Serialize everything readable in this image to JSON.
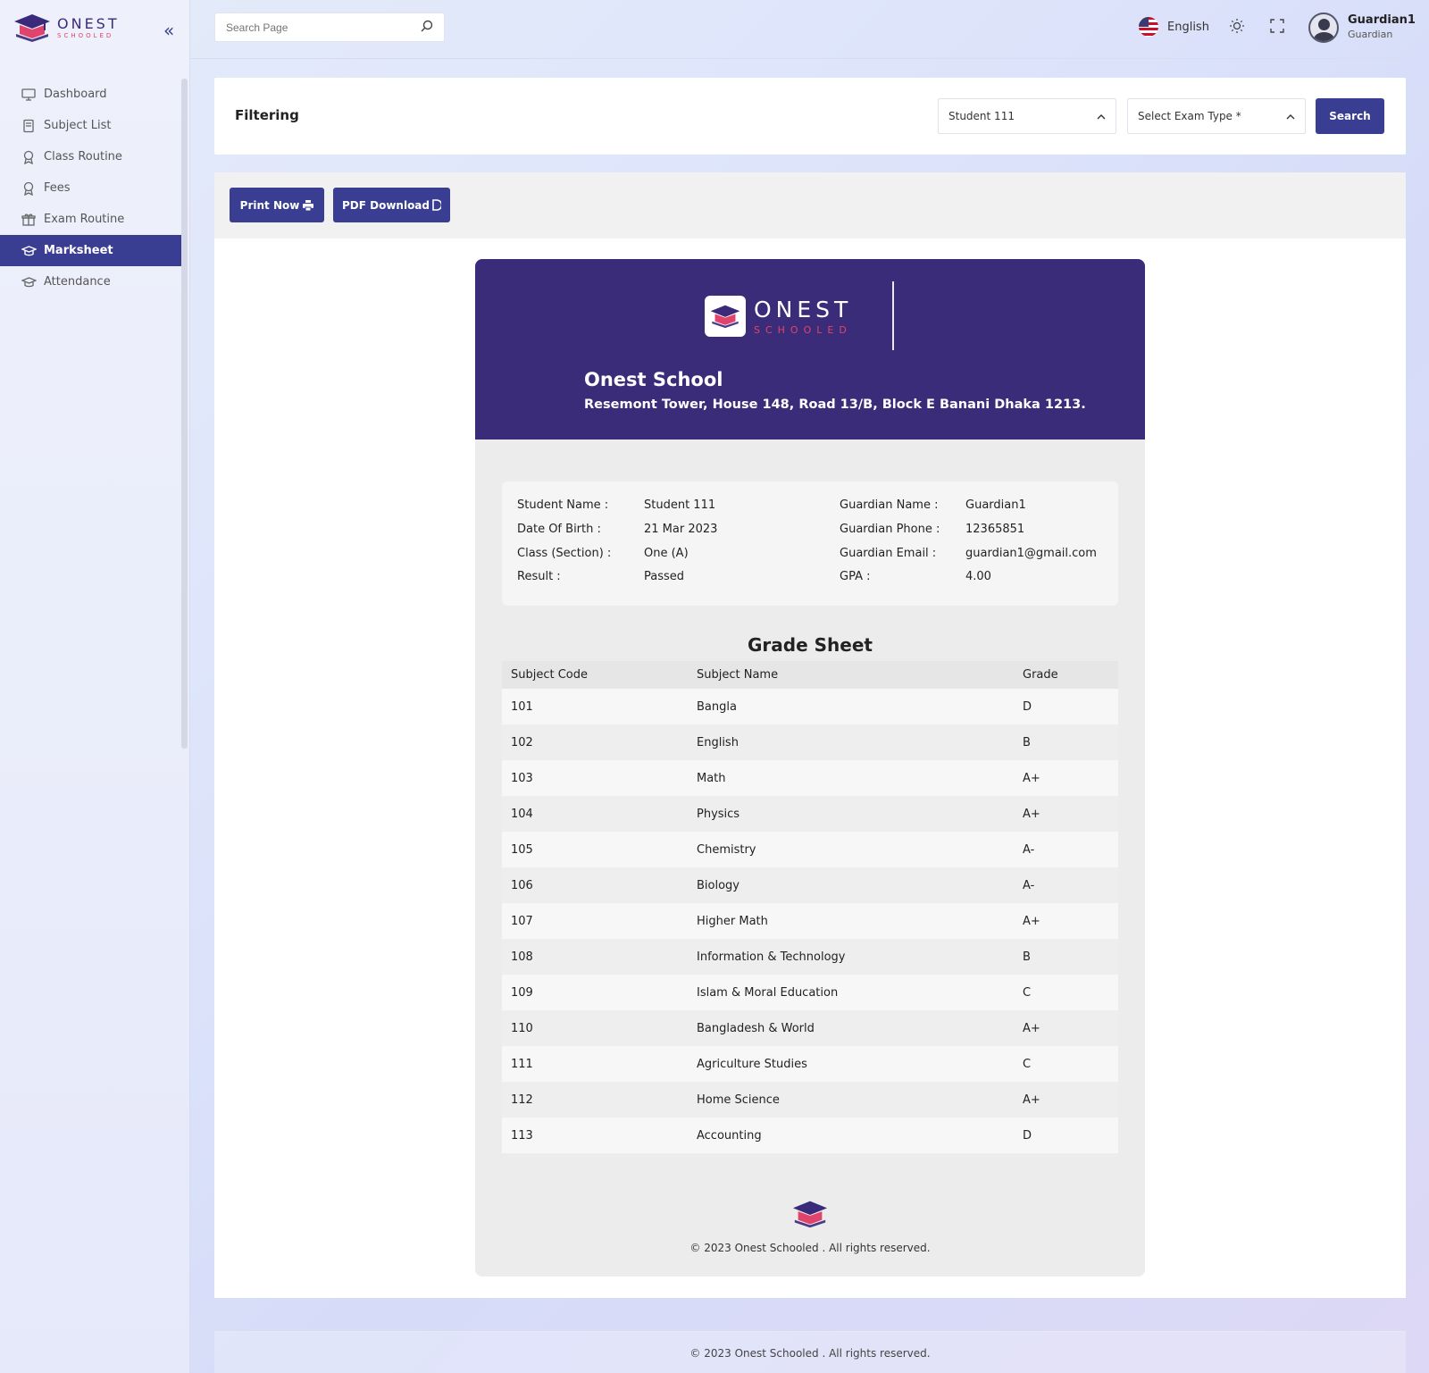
{
  "app": {
    "brand_name": "ONEST",
    "brand_sub": "SCHOOLED",
    "accent": "#3a3e93",
    "sheet_header_color": "#3b2c7a",
    "brand_pink": "#e0436b"
  },
  "sidebar": {
    "collapse_icon": "chevrons-left-icon",
    "items": [
      {
        "label": "Dashboard",
        "icon": "monitor-icon"
      },
      {
        "label": "Subject List",
        "icon": "book-icon"
      },
      {
        "label": "Class Routine",
        "icon": "award-icon"
      },
      {
        "label": "Fees",
        "icon": "award-icon"
      },
      {
        "label": "Exam Routine",
        "icon": "gift-icon"
      },
      {
        "label": "Marksheet",
        "icon": "graduation-cap-icon",
        "active": true
      },
      {
        "label": "Attendance",
        "icon": "graduation-cap-icon"
      }
    ]
  },
  "header": {
    "search_placeholder": "Search Page",
    "language": "English",
    "user_name": "Guardian1",
    "user_role": "Guardian"
  },
  "filter": {
    "title": "Filtering",
    "student_select": "Student 111",
    "exam_type_select": "Select Exam Type *",
    "search_label": "Search"
  },
  "actions": {
    "print_label": "Print Now",
    "pdf_label": "PDF Download"
  },
  "marksheet": {
    "logo_name": "ONEST",
    "logo_sub": "SCHOOLED",
    "school_name": "Onest School",
    "school_address": "Resemont Tower, House 148, Road 13/B, Block E Banani Dhaka 1213.",
    "student_info": [
      {
        "label": "Student Name :",
        "value": "Student 111"
      },
      {
        "label": "Date Of Birth :",
        "value": "21 Mar 2023"
      },
      {
        "label": "Class (Section) :",
        "value": "One (A)"
      },
      {
        "label": "Result :",
        "value": "Passed"
      }
    ],
    "guardian_info": [
      {
        "label": "Guardian Name :",
        "value": "Guardian1"
      },
      {
        "label": "Guardian Phone :",
        "value": "12365851"
      },
      {
        "label": "Guardian Email :",
        "value": "guardian1@gmail.com"
      },
      {
        "label": "GPA :",
        "value": "4.00"
      }
    ],
    "grade_title": "Grade Sheet",
    "columns": [
      "Subject Code",
      "Subject Name",
      "Grade"
    ],
    "rows": [
      [
        "101",
        "Bangla",
        "D"
      ],
      [
        "102",
        "English",
        "B"
      ],
      [
        "103",
        "Math",
        "A+"
      ],
      [
        "104",
        "Physics",
        "A+"
      ],
      [
        "105",
        "Chemistry",
        "A-"
      ],
      [
        "106",
        "Biology",
        "A-"
      ],
      [
        "107",
        "Higher Math",
        "A+"
      ],
      [
        "108",
        "Information & Technology",
        "B"
      ],
      [
        "109",
        "Islam & Moral Education",
        "C"
      ],
      [
        "110",
        "Bangladesh & World",
        "A+"
      ],
      [
        "111",
        "Agriculture Studies",
        "C"
      ],
      [
        "112",
        "Home Science",
        "A+"
      ],
      [
        "113",
        "Accounting",
        "D"
      ]
    ],
    "copyright": "© 2023 Onest Schooled . All rights reserved."
  },
  "footer": {
    "copyright": "© 2023 Onest Schooled . All rights reserved."
  }
}
